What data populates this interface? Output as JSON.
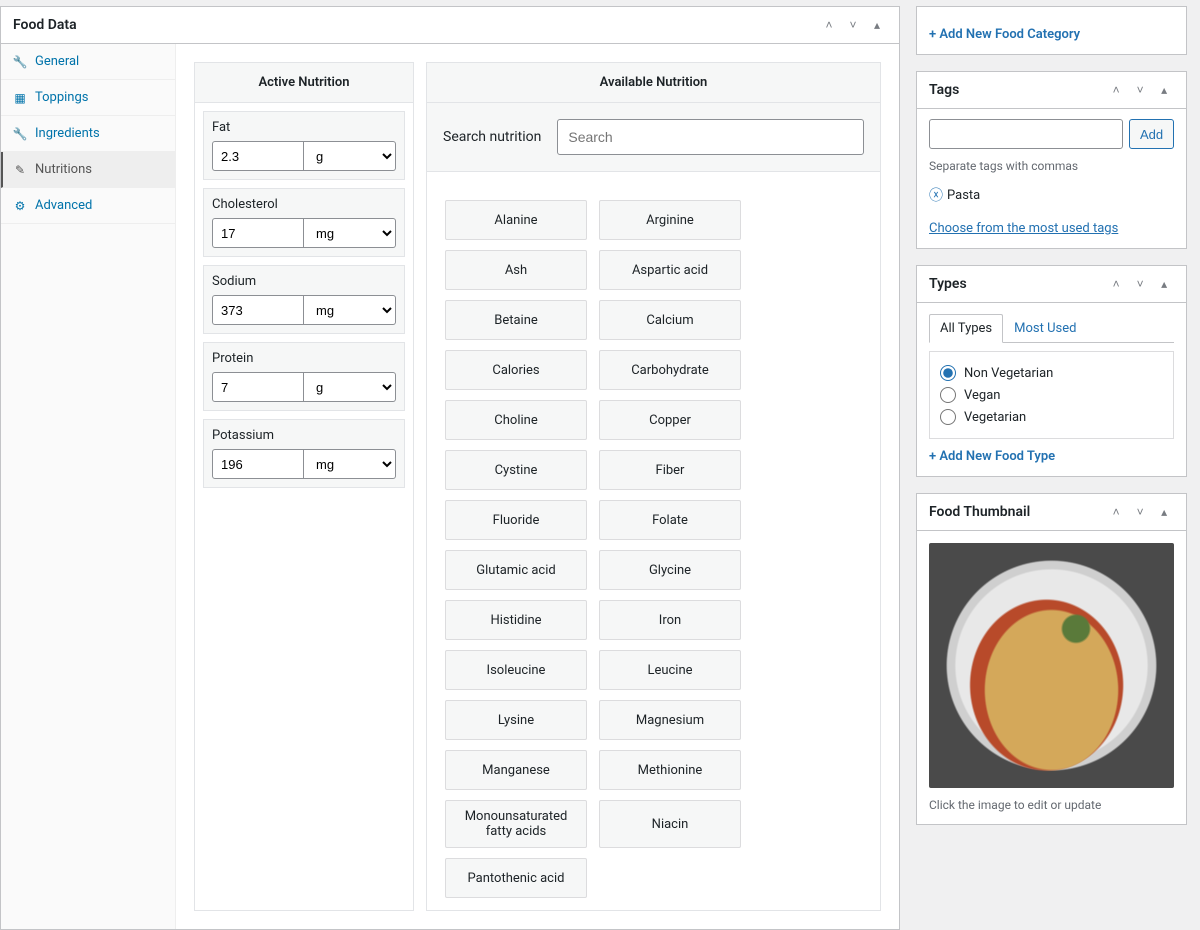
{
  "panel": {
    "title": "Food Data"
  },
  "nav": [
    {
      "label": "General",
      "icon": "wrench"
    },
    {
      "label": "Toppings",
      "icon": "grid"
    },
    {
      "label": "Ingredients",
      "icon": "wrench"
    },
    {
      "label": "Nutritions",
      "icon": "pencil"
    },
    {
      "label": "Advanced",
      "icon": "gear"
    }
  ],
  "active_nutrition": {
    "title": "Active Nutrition",
    "items": [
      {
        "name": "Fat",
        "value": "2.3",
        "unit": "g"
      },
      {
        "name": "Cholesterol",
        "value": "17",
        "unit": "mg"
      },
      {
        "name": "Sodium",
        "value": "373",
        "unit": "mg"
      },
      {
        "name": "Protein",
        "value": "7",
        "unit": "g"
      },
      {
        "name": "Potassium",
        "value": "196",
        "unit": "mg"
      }
    ]
  },
  "available_nutrition": {
    "title": "Available Nutrition",
    "search_label": "Search nutrition",
    "search_placeholder": "Search",
    "items": [
      "Alanine",
      "Arginine",
      "Ash",
      "Aspartic acid",
      "Betaine",
      "Calcium",
      "Calories",
      "Carbohydrate",
      "Choline",
      "Copper",
      "Cystine",
      "Fiber",
      "Fluoride",
      "Folate",
      "Glutamic acid",
      "Glycine",
      "Histidine",
      "Iron",
      "Isoleucine",
      "Leucine",
      "Lysine",
      "Magnesium",
      "Manganese",
      "Methionine",
      "Monounsaturated fatty acids",
      "Niacin",
      "Pantothenic acid"
    ]
  },
  "categories": {
    "add_link": "+ Add New Food Category"
  },
  "tags": {
    "title": "Tags",
    "add_button": "Add",
    "hint": "Separate tags with commas",
    "chip": "Pasta",
    "choose_link": "Choose from the most used tags"
  },
  "types": {
    "title": "Types",
    "tabs": [
      "All Types",
      "Most Used"
    ],
    "options": [
      "Non Vegetarian",
      "Vegan",
      "Vegetarian"
    ],
    "selected": "Non Vegetarian",
    "add_link": "+ Add New Food Type"
  },
  "thumbnail": {
    "title": "Food Thumbnail",
    "caption": "Click the image to edit or update"
  }
}
